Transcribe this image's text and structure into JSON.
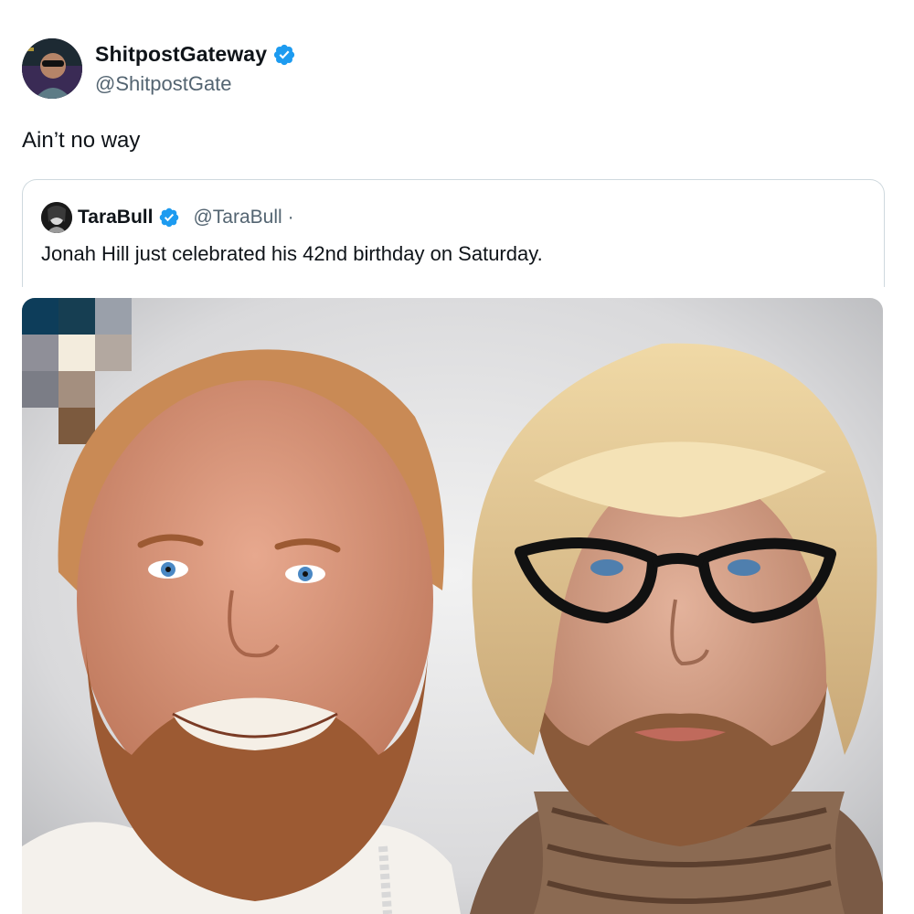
{
  "tweet": {
    "author": {
      "display_name": "ShitpostGateway",
      "handle": "@ShitpostGate",
      "verified": true,
      "verified_icon": "verified-badge-icon"
    },
    "text": "Ain’t no way"
  },
  "quoted_tweet": {
    "author": {
      "display_name": "TaraBull",
      "handle": "@TaraBull",
      "separator": "·",
      "verified": true,
      "verified_icon": "verified-badge-icon"
    },
    "text": "Jonah Hill just celebrated his 42nd birthday on Saturday."
  },
  "colors": {
    "verified_blue": "#1d9bf0",
    "handle_gray": "#536471",
    "border": "#cfd9de"
  }
}
